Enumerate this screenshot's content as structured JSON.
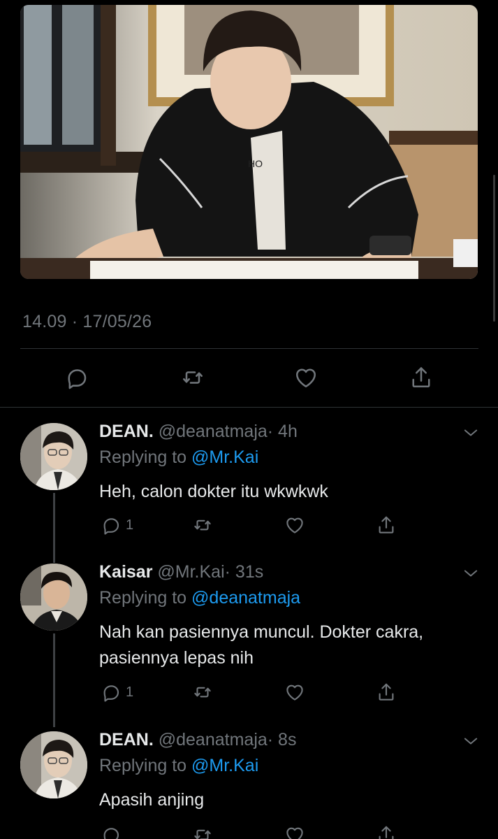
{
  "tweet": {
    "timestamp": "14.09 · 17/05/26",
    "photo_label": "HO"
  },
  "icons": {
    "reply": "reply-icon",
    "retweet": "retweet-icon",
    "like": "heart-icon",
    "share": "share-icon",
    "more": "chevron-down-icon"
  },
  "colors": {
    "background": "#000000",
    "text": "#e7e9ea",
    "muted": "#71767b",
    "mention": "#1d9bf0",
    "divider": "#2f3336"
  },
  "replies": [
    {
      "name": "DEAN.",
      "handle": "@deanatmaja",
      "time": "· 4h",
      "replying_prefix": "Replying to",
      "replying_to": "@Mr.Kai",
      "text": "Heh, calon dokter itu wkwkwk",
      "reply_count": "1"
    },
    {
      "name": "Kaisar",
      "handle": "@Mr.Kai",
      "time": "· 31s",
      "replying_prefix": "Replying to",
      "replying_to": "@deanatmaja",
      "text": "Nah kan pasiennya muncul. Dokter cakra, pasiennya lepas nih",
      "reply_count": "1"
    },
    {
      "name": "DEAN.",
      "handle": "@deanatmaja",
      "time": "· 8s",
      "replying_prefix": "Replying to",
      "replying_to": "@Mr.Kai",
      "text": "Apasih anjing",
      "reply_count": ""
    }
  ]
}
